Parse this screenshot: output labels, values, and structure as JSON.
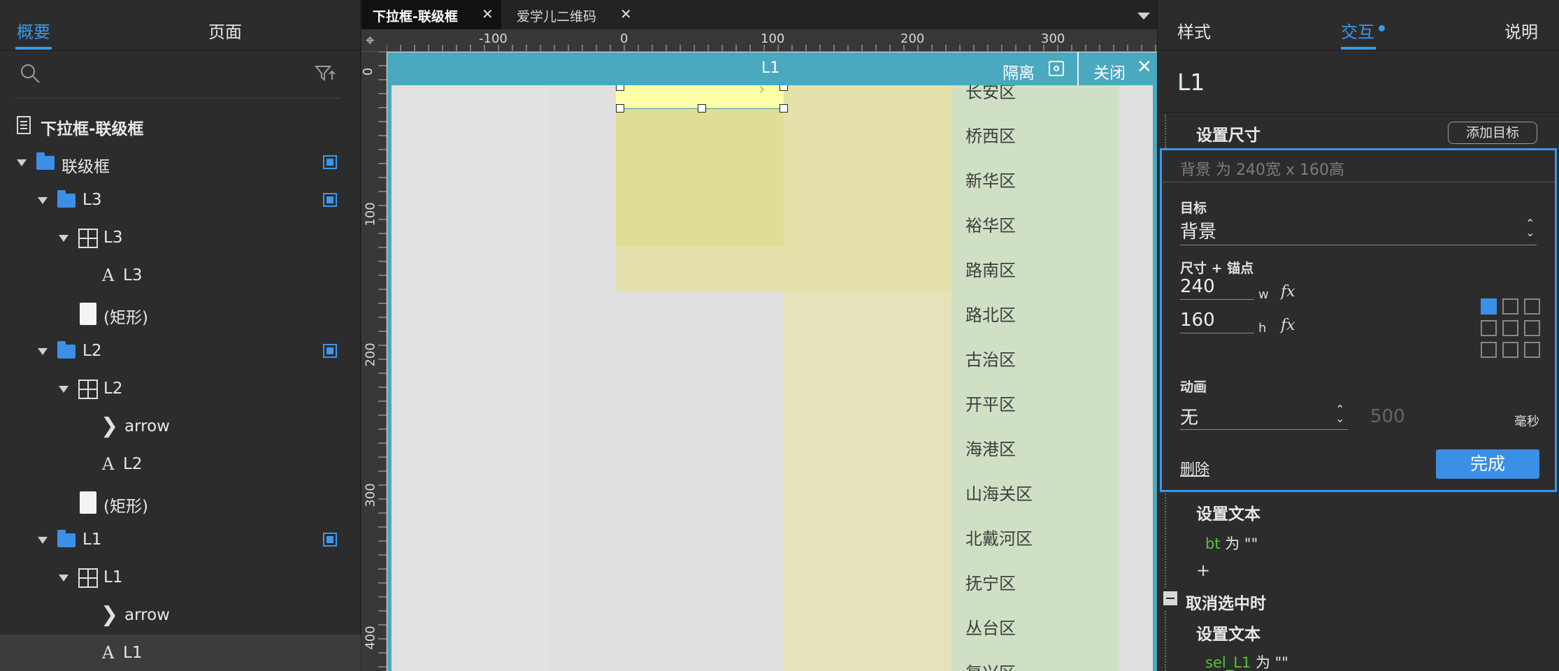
{
  "left_panel": {
    "tabs": [
      "概要",
      "页面"
    ],
    "page_name": "下拉框-联级框",
    "tree": [
      {
        "label": "联级框"
      },
      {
        "label": "L3"
      },
      {
        "label": "L3"
      },
      {
        "label": "L3"
      },
      {
        "label": "(矩形)"
      },
      {
        "label": "L2"
      },
      {
        "label": "L2"
      },
      {
        "label": "arrow"
      },
      {
        "label": "L2"
      },
      {
        "label": "(矩形)"
      },
      {
        "label": "L1"
      },
      {
        "label": "L1"
      },
      {
        "label": "arrow"
      },
      {
        "label": "L1"
      }
    ]
  },
  "doc_tabs": [
    {
      "label": "下拉框-联级框"
    },
    {
      "label": "爱学儿二维码"
    }
  ],
  "ruler": {
    "h_ticks": [
      "-100",
      "0",
      "100",
      "200",
      "300"
    ],
    "v_ticks": [
      "0",
      "100",
      "200",
      "300",
      "400"
    ]
  },
  "isolate_bar": {
    "title": "L1",
    "isolate_label": "隔离",
    "close_label": "关闭"
  },
  "districts": [
    "长安区",
    "桥西区",
    "新华区",
    "裕华区",
    "路南区",
    "路北区",
    "古治区",
    "开平区",
    "海港区",
    "山海关区",
    "北戴河区",
    "抚宁区",
    "丛台区",
    "复兴区"
  ],
  "right_panel": {
    "tabs": [
      "样式",
      "交互",
      "说明"
    ],
    "widget_name": "L1",
    "action_title": "设置尺寸",
    "add_target_label": "添加目标",
    "summary": "背景 为 240宽 x 160高",
    "target_label": "目标",
    "target_value": "背景",
    "size_anchor_label": "尺寸 + 锚点",
    "width_value": "240",
    "width_unit": "w",
    "height_value": "160",
    "height_unit": "h",
    "fx_label": "fx",
    "anim_label": "动画",
    "anim_value": "无",
    "duration_value": "500",
    "ms_label": "毫秒",
    "delete_label": "删除",
    "done_label": "完成",
    "set_text_1": "设置文本",
    "code_1_var": "bt",
    "code_1_rest": " 为 \"\"",
    "plus_label": "+",
    "event_title": "取消选中时",
    "set_text_2": "设置文本",
    "code_2_var": "sel_L1",
    "code_2_rest": " 为 \"\""
  }
}
